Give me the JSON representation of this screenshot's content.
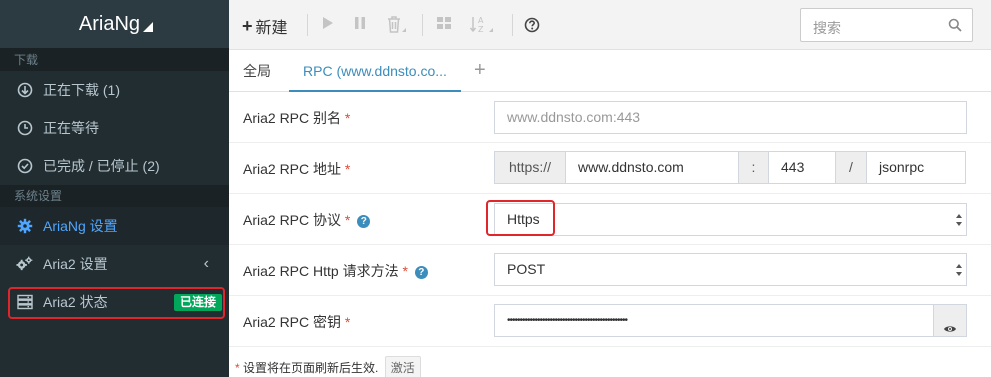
{
  "sidebar": {
    "logo": "AriaNg",
    "section_download": "下载",
    "downloading": "正在下载 (1)",
    "waiting": "正在等待",
    "stopped": "已完成 / 已停止 (2)",
    "section_settings": "系统设置",
    "ariang_settings": "AriaNg 设置",
    "aria2_settings": "Aria2 设置",
    "aria2_status": "Aria2 状态",
    "connected_badge": "已连接"
  },
  "toolbar": {
    "new_label": "新建",
    "search_placeholder": "搜索"
  },
  "tabs": {
    "global": "全局",
    "rpc": "RPC (www.ddnsto.co..."
  },
  "form": {
    "alias_label": "Aria2 RPC 别名",
    "alias_placeholder": "www.ddnsto.com:443",
    "address_label": "Aria2 RPC 地址",
    "address_protocol": "https://",
    "address_host": "www.ddnsto.com",
    "address_colon": ":",
    "address_port": "443",
    "address_slash": "/",
    "address_path": "jsonrpc",
    "protocol_label": "Aria2 RPC 协议",
    "protocol_value": "Https",
    "method_label": "Aria2 RPC Http 请求方法",
    "method_value": "POST",
    "secret_label": "Aria2 RPC 密钥",
    "secret_value": "••••••••••••••••••••••••••••••••••••••••••••••••",
    "required_mark": "*"
  },
  "footer": {
    "note": "设置将在页面刷新后生效.",
    "activate": "激活"
  },
  "colors": {
    "sidebar_bg": "#222d32",
    "accent": "#3c8dbc",
    "active_link": "#4fa6ff",
    "success": "#00a65a",
    "highlight": "#e0262b"
  }
}
